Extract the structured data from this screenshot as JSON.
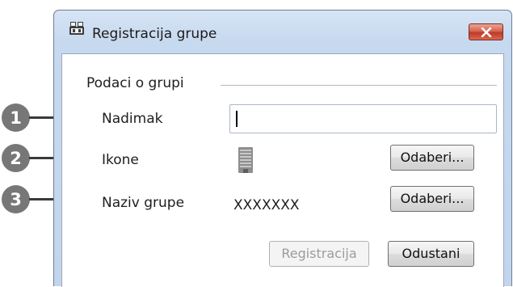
{
  "window": {
    "title": "Registracija grupe",
    "close_icon": "close-x-icon",
    "app_icon": "group-registration-icon"
  },
  "group": {
    "label": "Podaci o grupi"
  },
  "fields": {
    "nickname_label": "Nadimak",
    "nickname_value": "",
    "icons_label": "Ikone",
    "icons_value_icon": "building-icon",
    "icons_select_label": "Odaberi...",
    "group_name_label": "Naziv grupe",
    "group_name_value": "XXXXXXX",
    "group_name_select_label": "Odaberi..."
  },
  "buttons": {
    "register_label": "Registracija",
    "cancel_label": "Odustani"
  },
  "callouts": [
    "1",
    "2",
    "3"
  ],
  "colors": {
    "titlebar": "#c7d9ef",
    "close_button": "#c0392b",
    "callout": "#777777"
  }
}
